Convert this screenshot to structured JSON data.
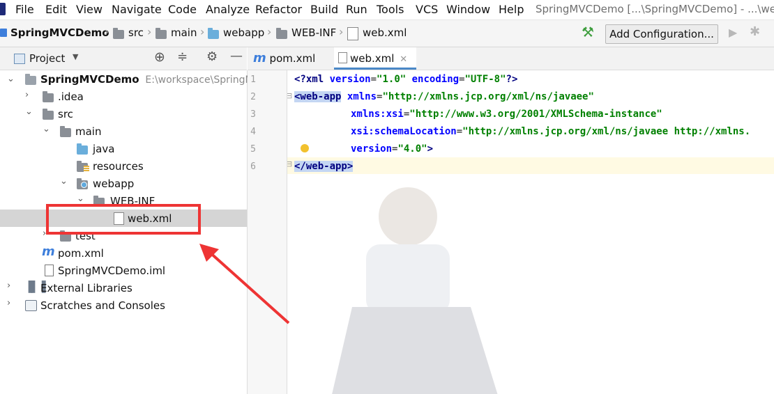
{
  "menu": [
    "File",
    "Edit",
    "View",
    "Navigate",
    "Code",
    "Analyze",
    "Refactor",
    "Build",
    "Run",
    "Tools",
    "VCS",
    "Window",
    "Help"
  ],
  "window_title": "SpringMVCDemo [...\\SpringMVCDemo] - ...\\we",
  "breadcrumbs": [
    "SpringMVCDemo",
    "src",
    "main",
    "webapp",
    "WEB-INF",
    "web.xml"
  ],
  "toolbar": {
    "add_configuration": "Add Configuration..."
  },
  "project_panel": {
    "title": "Project"
  },
  "tree": [
    {
      "label": "SpringMVCDemo",
      "path": "E:\\workspace\\SpringM"
    },
    {
      "label": ".idea"
    },
    {
      "label": "src"
    },
    {
      "label": "main"
    },
    {
      "label": "java"
    },
    {
      "label": "resources"
    },
    {
      "label": "webapp"
    },
    {
      "label": "WEB-INF"
    },
    {
      "label": "web.xml"
    },
    {
      "label": "test"
    },
    {
      "label": "pom.xml"
    },
    {
      "label": "SpringMVCDemo.iml"
    },
    {
      "label": "External Libraries"
    },
    {
      "label": "Scratches and Consoles"
    }
  ],
  "tabs": [
    {
      "label": "pom.xml"
    },
    {
      "label": "web.xml"
    }
  ],
  "editor": {
    "line_numbers": [
      "1",
      "2",
      "3",
      "4",
      "5",
      "6"
    ],
    "lines": [
      [
        "<?",
        "xml ",
        "version",
        "=",
        "\"1.0\"",
        " ",
        "encoding",
        "=",
        "\"UTF-8\"",
        "?>"
      ],
      [
        "<web-app",
        " ",
        "xmlns",
        "=",
        "\"http://xmlns.jcp.org/xml/ns/javaee\""
      ],
      [
        "xmlns:xsi",
        "=",
        "\"http://www.w3.org/2001/XMLSchema-instance\""
      ],
      [
        "xsi:schemaLocation",
        "=",
        "\"http://xmlns.jcp.org/xml/ns/javaee http://xmlns."
      ],
      [
        "version",
        "=",
        "\"4.0\"",
        ">"
      ],
      [
        "</web-app>"
      ]
    ]
  },
  "colors": {
    "annotation_red": "#ee3434",
    "selection": "#c4d6f3",
    "current_line": "#fffae3"
  },
  "icons": [
    "project-icon",
    "locate-icon",
    "collapse-icon",
    "settings-icon",
    "minimize-icon",
    "hammer-icon",
    "run-icon",
    "debug-icon",
    "bulb-icon"
  ]
}
